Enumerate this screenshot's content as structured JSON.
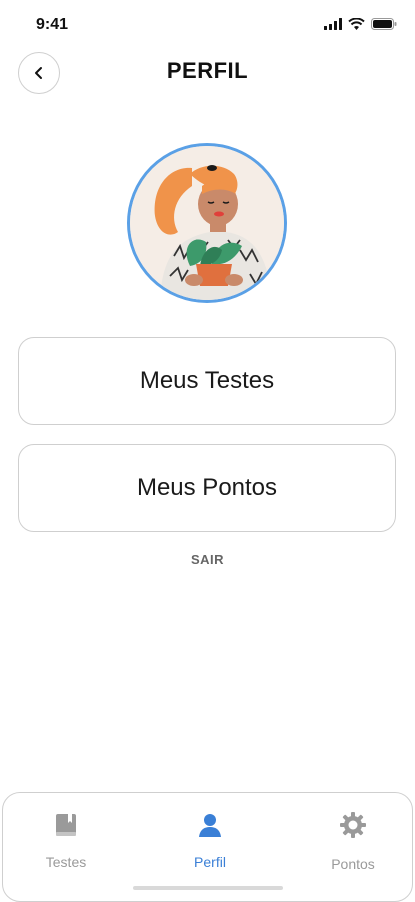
{
  "status_bar": {
    "time": "9:41",
    "icons": [
      "signal-icon",
      "wifi-icon",
      "battery-icon"
    ]
  },
  "header": {
    "back_icon": "chevron-left-icon",
    "title": "PERFIL"
  },
  "avatar": {
    "image": "woman-with-plant-illustration"
  },
  "menu": {
    "items": [
      {
        "label": "Meus Testes"
      },
      {
        "label": "Meus Pontos"
      }
    ]
  },
  "logout_label": "SAIR",
  "tab_bar": {
    "active": "Perfil",
    "active_color": "#3a7fd6",
    "inactive_color": "#9a9a9a",
    "tabs": [
      {
        "label": "Testes",
        "icon": "book-icon"
      },
      {
        "label": "Perfil",
        "icon": "user-icon"
      },
      {
        "label": "Pontos",
        "icon": "gear-icon"
      }
    ]
  },
  "colors": {
    "avatar_border": "#5aa0e6",
    "hair": "#f0934a",
    "shirt_pattern": "#333333",
    "leaves": "#3d9a6b"
  }
}
